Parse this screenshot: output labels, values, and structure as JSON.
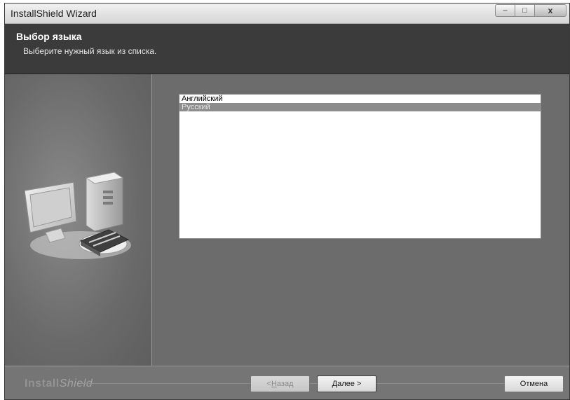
{
  "window": {
    "title": "InstallShield Wizard"
  },
  "window_controls": {
    "minimize": "–",
    "maximize": "□",
    "close": "x"
  },
  "header": {
    "title": "Выбор языка",
    "subtitle": "Выберите нужный язык из списка."
  },
  "languages": {
    "items": [
      "Английский",
      "Русский"
    ],
    "selected": "Русский"
  },
  "footer": {
    "brand_install": "Install",
    "brand_shield": "Shield",
    "back": {
      "prefix": "< ",
      "accel": "Н",
      "rest": "азад"
    },
    "next": {
      "accel": "Д",
      "rest": "алее >"
    },
    "cancel": "Отмена"
  }
}
